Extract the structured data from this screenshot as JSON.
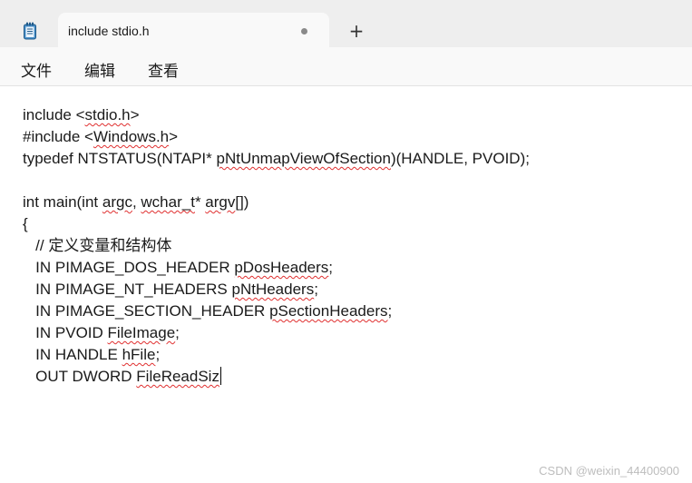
{
  "tab": {
    "title": "include stdio.h",
    "new_tab_label": "+"
  },
  "menu": {
    "items": [
      "文件",
      "编辑",
      "查看"
    ]
  },
  "editor": {
    "lines": [
      [
        {
          "t": "include <"
        },
        {
          "t": "stdio.h",
          "sq": true
        },
        {
          "t": ">"
        }
      ],
      [
        {
          "t": "#include <"
        },
        {
          "t": "Windows.h",
          "sq": true
        },
        {
          "t": ">"
        }
      ],
      [
        {
          "t": "typedef NTSTATUS(NTAPI* "
        },
        {
          "t": "pNtUnmapViewOfSection",
          "sq": true
        },
        {
          "t": ")(HANDLE, PVOID);"
        }
      ],
      [],
      [
        {
          "t": "int main(int "
        },
        {
          "t": "argc",
          "sq": true
        },
        {
          "t": ", "
        },
        {
          "t": "wchar_t",
          "sq": true
        },
        {
          "t": "* "
        },
        {
          "t": "argv",
          "sq": true
        },
        {
          "t": "[])"
        }
      ],
      [
        {
          "t": "{"
        }
      ],
      [
        {
          "t": "   // 定义变量和结构体"
        }
      ],
      [
        {
          "t": "   IN PIMAGE_DOS_HEADER "
        },
        {
          "t": "pDosHeaders",
          "sq": true
        },
        {
          "t": ";"
        }
      ],
      [
        {
          "t": "   IN PIMAGE_NT_HEADERS "
        },
        {
          "t": "pNtHeaders",
          "sq": true
        },
        {
          "t": ";"
        }
      ],
      [
        {
          "t": "   IN PIMAGE_SECTION_HEADER "
        },
        {
          "t": "pSectionHeaders",
          "sq": true
        },
        {
          "t": ";"
        }
      ],
      [
        {
          "t": "   IN PVOID "
        },
        {
          "t": "FileImage",
          "sq": true
        },
        {
          "t": ";"
        }
      ],
      [
        {
          "t": "   IN HANDLE "
        },
        {
          "t": "hFile",
          "sq": true
        },
        {
          "t": ";"
        }
      ],
      [
        {
          "t": "   OUT DWORD "
        },
        {
          "t": "FileReadSiz",
          "sq": true
        }
      ]
    ],
    "caret_line": 12
  },
  "watermark": "CSDN @weixin_44400900",
  "colors": {
    "titlebar": "#eeeeee",
    "tab": "#f9f9f9",
    "squiggle": "#e03030",
    "icon": "#2b6cb0"
  }
}
